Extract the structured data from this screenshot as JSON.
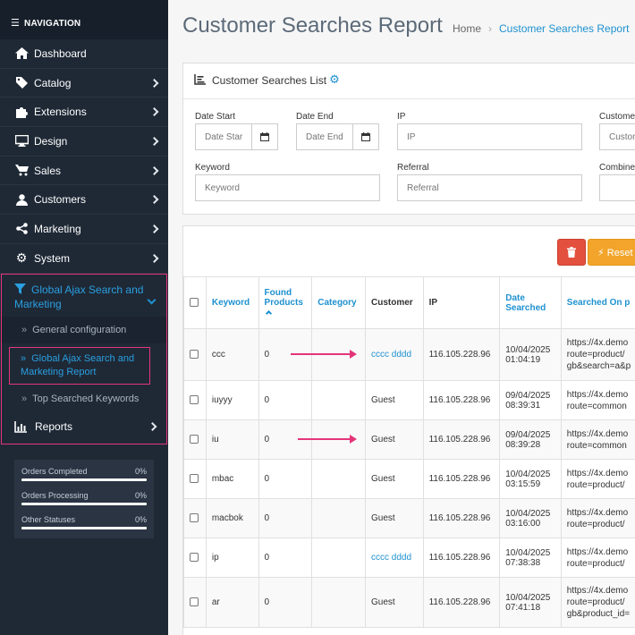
{
  "sidebar": {
    "header": "NAVIGATION",
    "items": [
      {
        "label": "Dashboard",
        "icon": "home-icon"
      },
      {
        "label": "Catalog",
        "icon": "tag-icon"
      },
      {
        "label": "Extensions",
        "icon": "puzzle-icon"
      },
      {
        "label": "Design",
        "icon": "monitor-icon"
      },
      {
        "label": "Sales",
        "icon": "cart-icon"
      },
      {
        "label": "Customers",
        "icon": "user-icon"
      },
      {
        "label": "Marketing",
        "icon": "share-icon"
      },
      {
        "label": "System",
        "icon": "gear-icon"
      }
    ],
    "ajax_menu": {
      "label": "Global Ajax Search and Marketing",
      "sub_general": "General configuration",
      "sub_report": "Global Ajax Search and Marketing Report",
      "sub_top": "Top Searched Keywords"
    },
    "reports_label": "Reports",
    "stats": [
      {
        "label": "Orders Completed",
        "value": "0%"
      },
      {
        "label": "Orders Processing",
        "value": "0%"
      },
      {
        "label": "Other Statuses",
        "value": "0%"
      }
    ]
  },
  "page": {
    "title": "Customer Searches Report",
    "breadcrumb_home": "Home",
    "breadcrumb_current": "Customer Searches Report"
  },
  "filter": {
    "panel_title": "Customer Searches List",
    "date_start_label": "Date Start",
    "date_start_placeholder": "Date Start",
    "date_end_label": "Date End",
    "date_end_placeholder": "Date End",
    "ip_label": "IP",
    "ip_placeholder": "IP",
    "customer_label": "Customer",
    "customer_placeholder": "Customer",
    "keyword_label": "Keyword",
    "keyword_placeholder": "Keyword",
    "referral_label": "Referral",
    "referral_placeholder": "Referral",
    "combined_label": "Combined"
  },
  "toolbar": {
    "reset_label": "Reset F"
  },
  "table": {
    "headers": {
      "keyword": "Keyword",
      "found_1": "Found",
      "found_2": "Products",
      "category": "Category",
      "customer": "Customer",
      "ip": "IP",
      "date_1": "Date",
      "date_2": "Searched",
      "searched_on": "Searched On p"
    },
    "rows": [
      {
        "keyword": "ccc",
        "found": "0",
        "category": "",
        "customer": "cccc dddd",
        "customer_link": true,
        "ip": "116.105.228.96",
        "date": "10/04/2025",
        "time": "01:04:19",
        "url1": "https://4x.demo",
        "url2": "route=product/",
        "url3": "gb&search=a&p"
      },
      {
        "keyword": "iuyyy",
        "found": "0",
        "category": "",
        "customer": "Guest",
        "customer_link": false,
        "ip": "116.105.228.96",
        "date": "09/04/2025",
        "time": "08:39:31",
        "url1": "https://4x.demo",
        "url2": "route=common",
        "url3": ""
      },
      {
        "keyword": "iu",
        "found": "0",
        "category": "",
        "customer": "Guest",
        "customer_link": false,
        "ip": "116.105.228.96",
        "date": "09/04/2025",
        "time": "08:39:28",
        "url1": "https://4x.demo",
        "url2": "route=common",
        "url3": ""
      },
      {
        "keyword": "mbac",
        "found": "0",
        "category": "",
        "customer": "Guest",
        "customer_link": false,
        "ip": "116.105.228.96",
        "date": "10/04/2025",
        "time": "03:15:59",
        "url1": "https://4x.demo",
        "url2": "route=product/",
        "url3": ""
      },
      {
        "keyword": "macbok",
        "found": "0",
        "category": "",
        "customer": "Guest",
        "customer_link": false,
        "ip": "116.105.228.96",
        "date": "10/04/2025",
        "time": "03:16:00",
        "url1": "https://4x.demo",
        "url2": "route=product/",
        "url3": ""
      },
      {
        "keyword": "ip",
        "found": "0",
        "category": "",
        "customer": "cccc dddd",
        "customer_link": true,
        "ip": "116.105.228.96",
        "date": "10/04/2025",
        "time": "07:38:38",
        "url1": "https://4x.demo",
        "url2": "route=product/",
        "url3": ""
      },
      {
        "keyword": "ar",
        "found": "0",
        "category": "",
        "customer": "Guest",
        "customer_link": false,
        "ip": "116.105.228.96",
        "date": "10/04/2025",
        "time": "07:41:18",
        "url1": "https://4x.demo",
        "url2": "route=product/",
        "url3": "gb&product_id="
      }
    ]
  },
  "colors": {
    "sidebar_bg": "#1f2936",
    "accent": "#1e91cf",
    "highlight": "#e4357a",
    "danger": "#e3503e",
    "warning": "#f2a52a"
  }
}
